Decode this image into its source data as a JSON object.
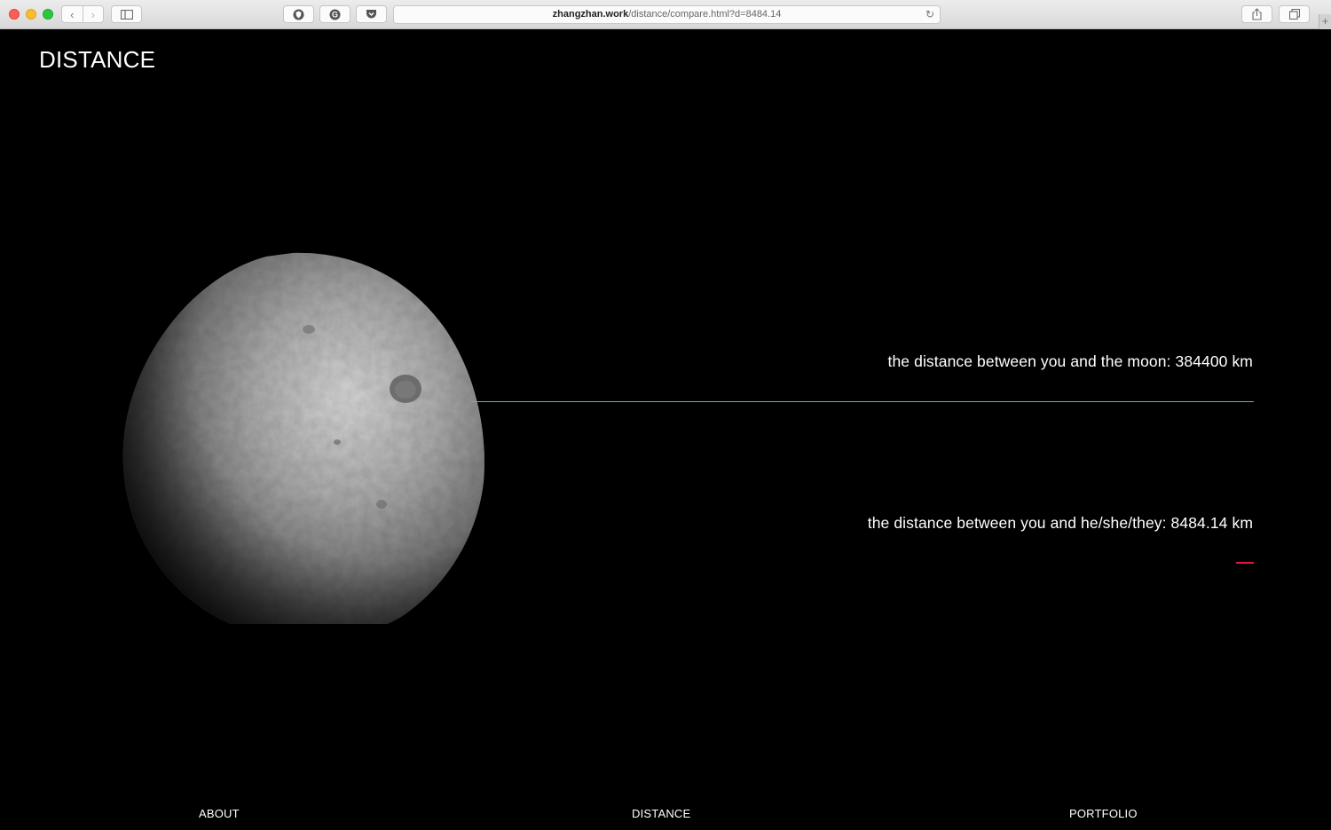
{
  "browser": {
    "url_host": "zhangzhan.work",
    "url_path": "/distance/compare.html?d=8484.14",
    "back_icon": "chevron-left-icon",
    "forward_icon": "chevron-right-icon",
    "sidebar_icon": "sidebar-icon",
    "shield_icon": "shield-icon",
    "grammarly_icon": "grammarly-icon",
    "pocket_icon": "pocket-icon",
    "reload_icon": "reload-icon",
    "share_icon": "share-icon",
    "tabs_icon": "tabs-icon",
    "new_tab_icon": "plus-icon",
    "glyphs": {
      "back": "‹",
      "forward": "›",
      "reload": "↻",
      "new_tab": "+",
      "shield": "◉",
      "grammarly": "G",
      "pocket": "⌄",
      "share": "⇪",
      "tabs": "❐",
      "sidebar": "▯"
    }
  },
  "site": {
    "title": "DISTANCE"
  },
  "comparison": {
    "moon_text": "the distance between you and the moon: 384400 km",
    "person_text": "the distance between you and he/she/they: 8484.14 km",
    "moon_distance_km": 384400,
    "person_distance_km": 8484.14,
    "moon_line_color": "#36c3d6",
    "person_line_color": "#e5173f"
  },
  "footer": {
    "about": "ABOUT",
    "distance": "DISTANCE",
    "portfolio": "PORTFOLIO"
  }
}
